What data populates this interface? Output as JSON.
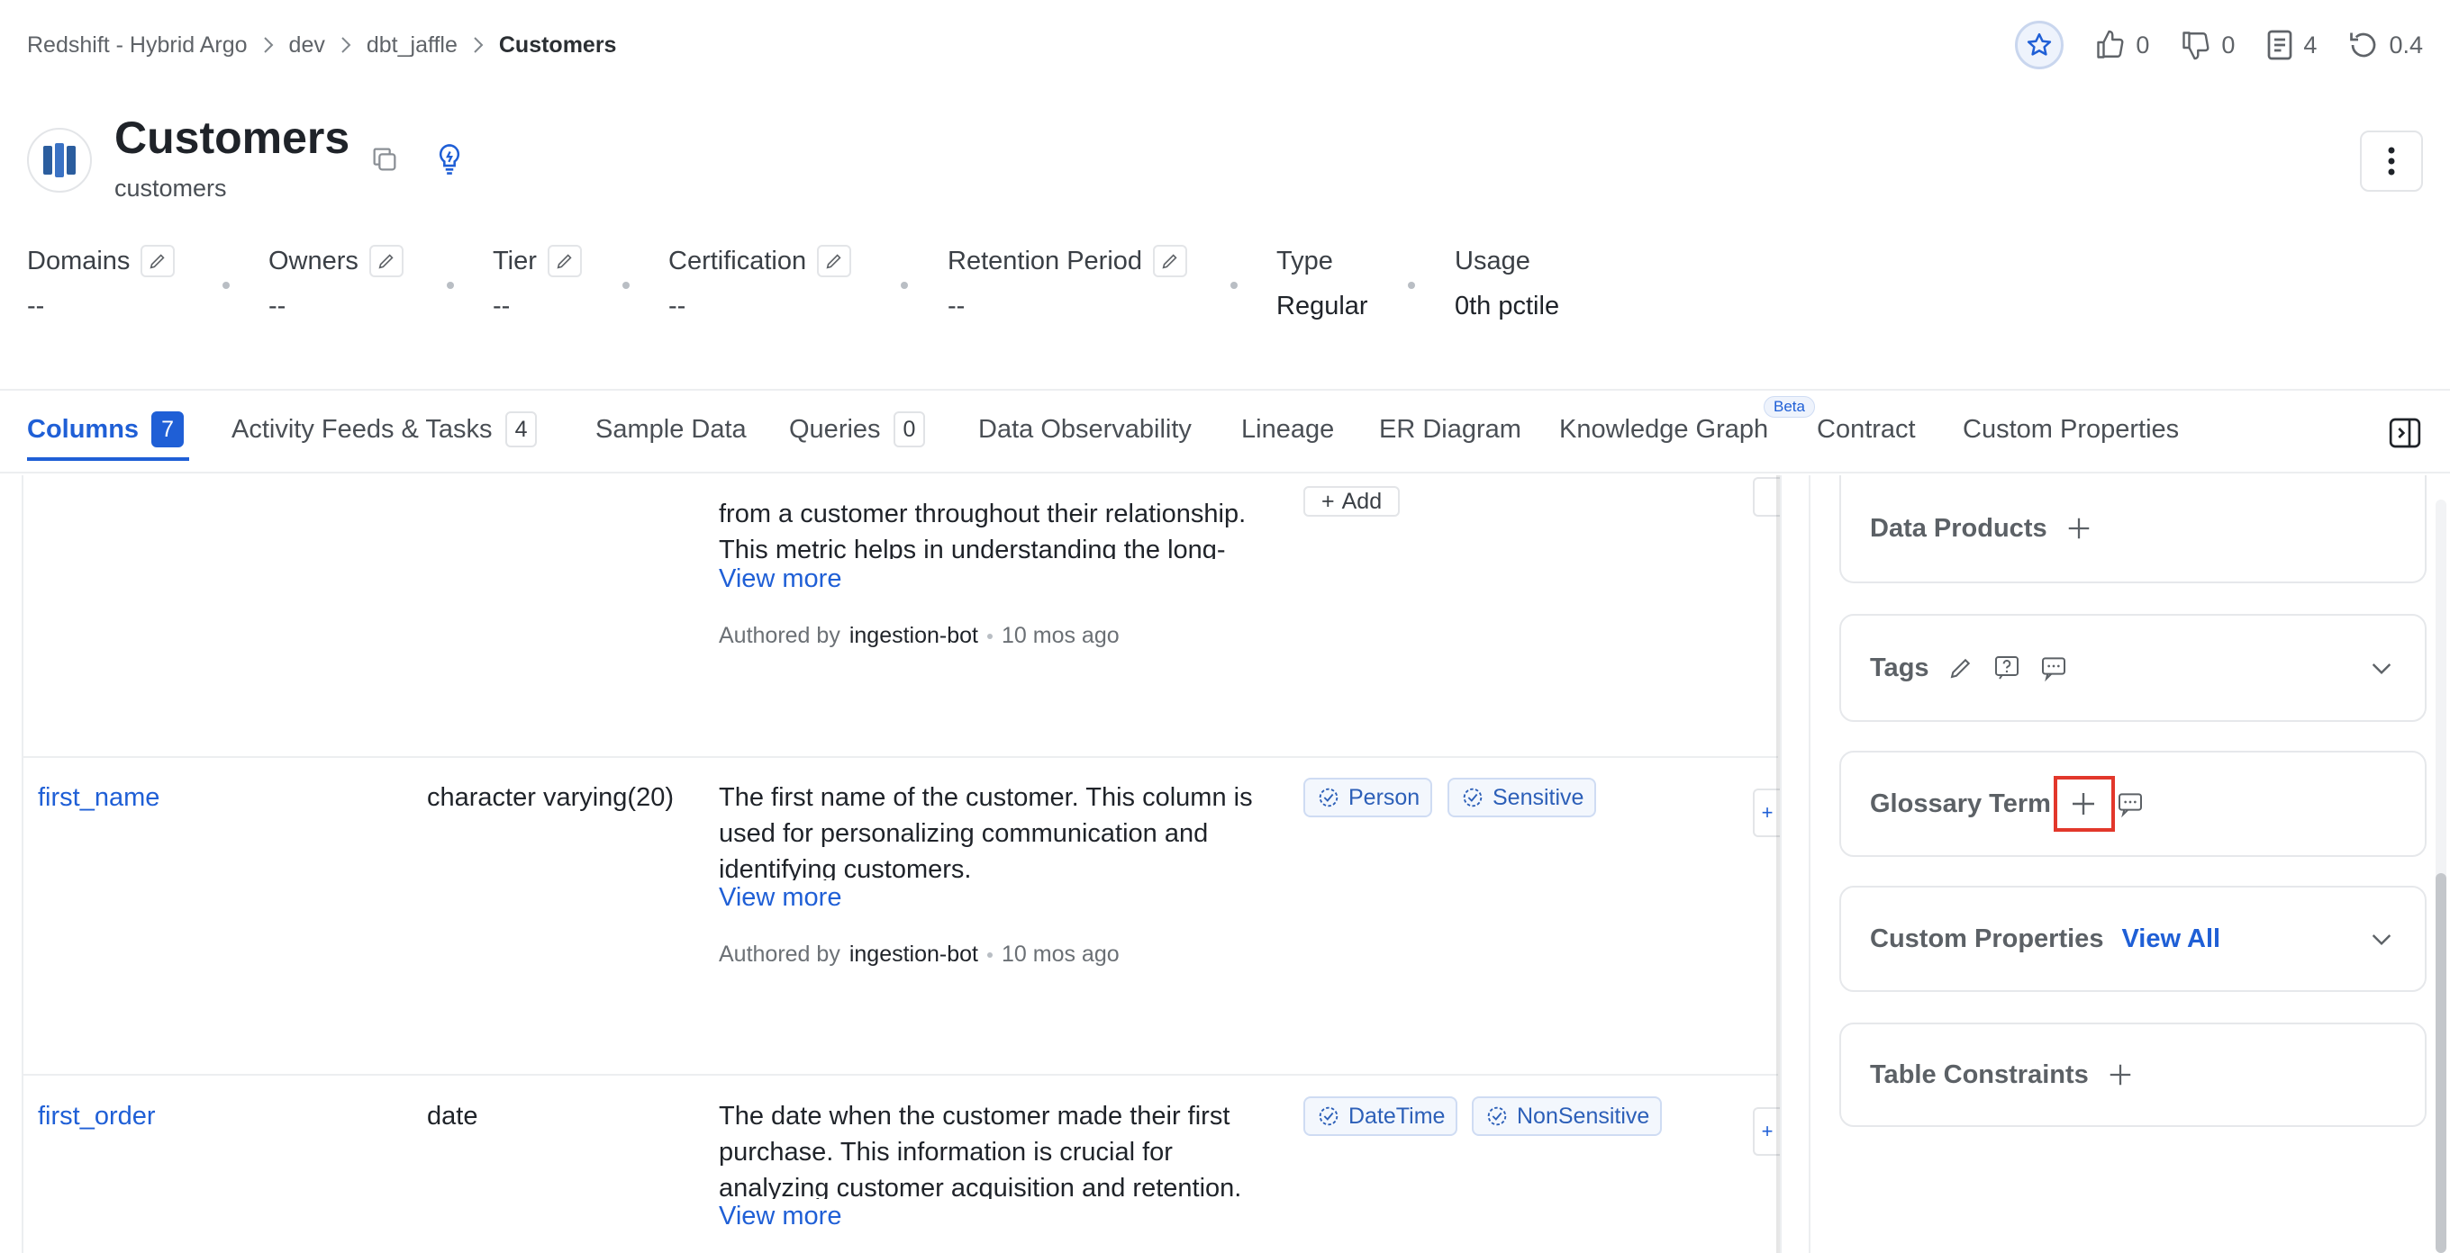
{
  "breadcrumb": [
    "Redshift - Hybrid Argo",
    "dev",
    "dbt_jaffle",
    "Customers"
  ],
  "actions": {
    "likes": "0",
    "dislikes": "0",
    "tasks": "4",
    "version": "0.4"
  },
  "header": {
    "title": "Customers",
    "subtitle": "customers"
  },
  "properties": [
    {
      "label": "Domains",
      "value": "--"
    },
    {
      "label": "Owners",
      "value": "--"
    },
    {
      "label": "Tier",
      "value": "--"
    },
    {
      "label": "Certification",
      "value": "--"
    },
    {
      "label": "Retention Period",
      "value": "--"
    },
    {
      "label": "Type",
      "value": "Regular"
    },
    {
      "label": "Usage",
      "value": "0th pctile"
    }
  ],
  "tabs": [
    {
      "label": "Columns",
      "count": "7"
    },
    {
      "label": "Activity Feeds & Tasks",
      "count": "4"
    },
    {
      "label": "Sample Data"
    },
    {
      "label": "Queries",
      "count": "0"
    },
    {
      "label": "Data Observability"
    },
    {
      "label": "Lineage"
    },
    {
      "label": "ER Diagram"
    },
    {
      "label": "Knowledge Graph",
      "badge": "Beta"
    },
    {
      "label": "Contract"
    },
    {
      "label": "Custom Properties"
    }
  ],
  "rows": [
    {
      "name": "",
      "type": "",
      "desc_lines": [
        "from a customer throughout their relationship.",
        "This metric helps in understanding the long-"
      ],
      "view_more": "View more",
      "authored_by": "Authored by",
      "author": "ingestion-bot",
      "time": "10 mos ago",
      "add_label": "Add"
    },
    {
      "name": "first_name",
      "type": "character varying(20)",
      "desc_lines": [
        "The first name of the customer. This column is",
        "used for personalizing communication and",
        "identifying customers."
      ],
      "view_more": "View more",
      "authored_by": "Authored by",
      "author": "ingestion-bot",
      "time": "10 mos ago",
      "tags": [
        "Person",
        "Sensitive"
      ]
    },
    {
      "name": "first_order",
      "type": "date",
      "desc_lines": [
        "The date when the customer made their first",
        "purchase. This information is crucial for",
        "analyzing customer acquisition and retention."
      ],
      "view_more": "View more",
      "tags": [
        "DateTime",
        "NonSensitive"
      ]
    }
  ],
  "panel": {
    "data_products": "Data Products",
    "tags": "Tags",
    "glossary_term": "Glossary Term",
    "custom_properties": "Custom Properties",
    "view_all": "View All",
    "table_constraints": "Table Constraints"
  },
  "colors": {
    "accent": "#1f5fd6",
    "highlight": "#e2372b"
  }
}
